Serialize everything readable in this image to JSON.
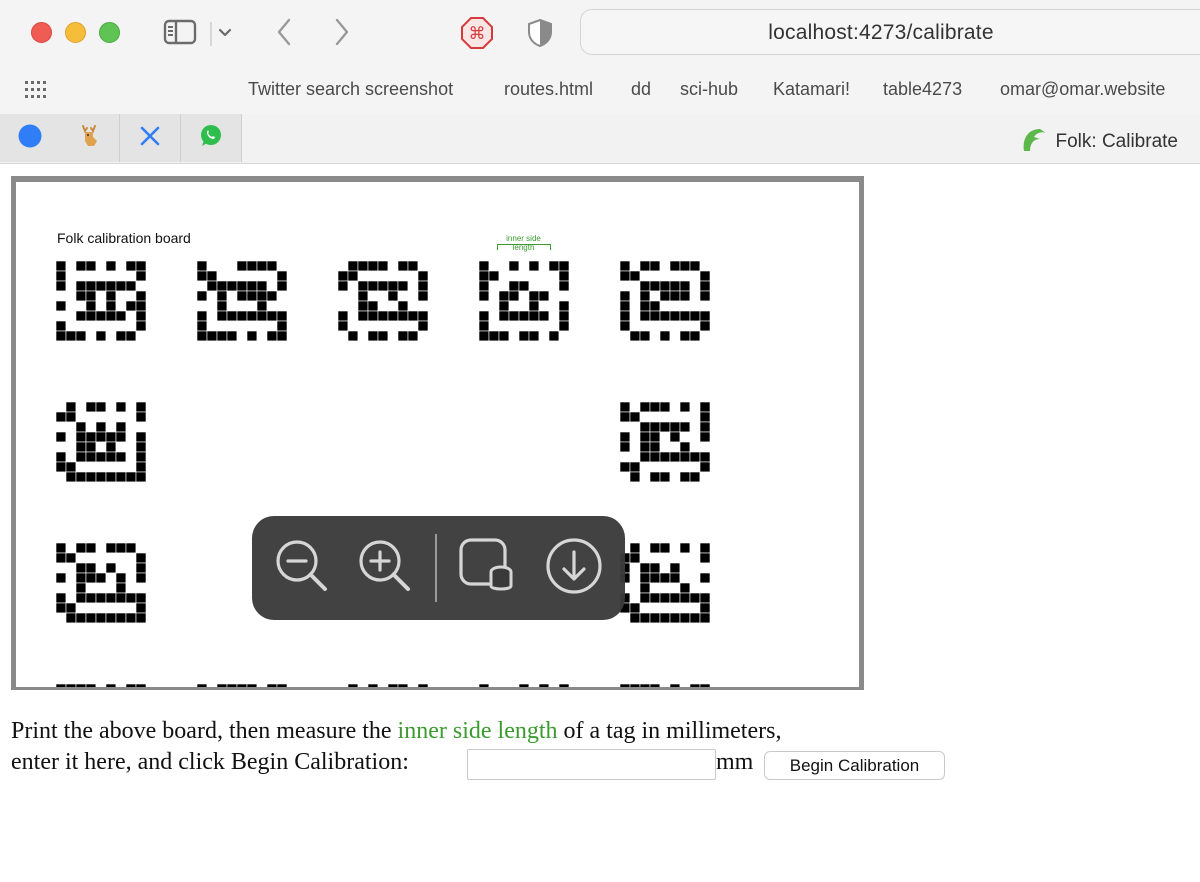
{
  "browser": {
    "url": "localhost:4273/calibrate",
    "bookmarks": [
      "Twitter search screenshot",
      "routes.html",
      "dd",
      "sci-hub",
      "Katamari!",
      "table4273",
      "omar@omar.website"
    ],
    "pinned_tabs": [
      "messages-icon",
      "deer-icon",
      "x-icon",
      "whatsapp-icon"
    ],
    "active_tab_title": "Folk: Calibrate",
    "icons": [
      "sidebar-icon",
      "chevron-down-icon",
      "back-icon",
      "forward-icon",
      "command-icon",
      "shield-icon",
      "apps-grid-icon",
      "folk-logo-icon"
    ]
  },
  "board": {
    "title": "Folk calibration board",
    "inner_label": "inner side length"
  },
  "zoom_overlay": {
    "buttons": [
      "zoom-out-icon",
      "zoom-in-icon",
      "preview-icon",
      "download-icon"
    ]
  },
  "instructions": {
    "line1_before": "Print the above board, then measure the ",
    "highlight": "inner side length",
    "line1_after": " of a tag in millimeters,",
    "line2": "enter it here, and click Begin Calibration:",
    "input_value": "",
    "unit": "mm",
    "button_label": "Begin Calibration"
  },
  "colors": {
    "accent_green": "#3b9b2f",
    "close": "#ee5c53",
    "minimize": "#f6bd3b",
    "maximize": "#5fc454"
  }
}
